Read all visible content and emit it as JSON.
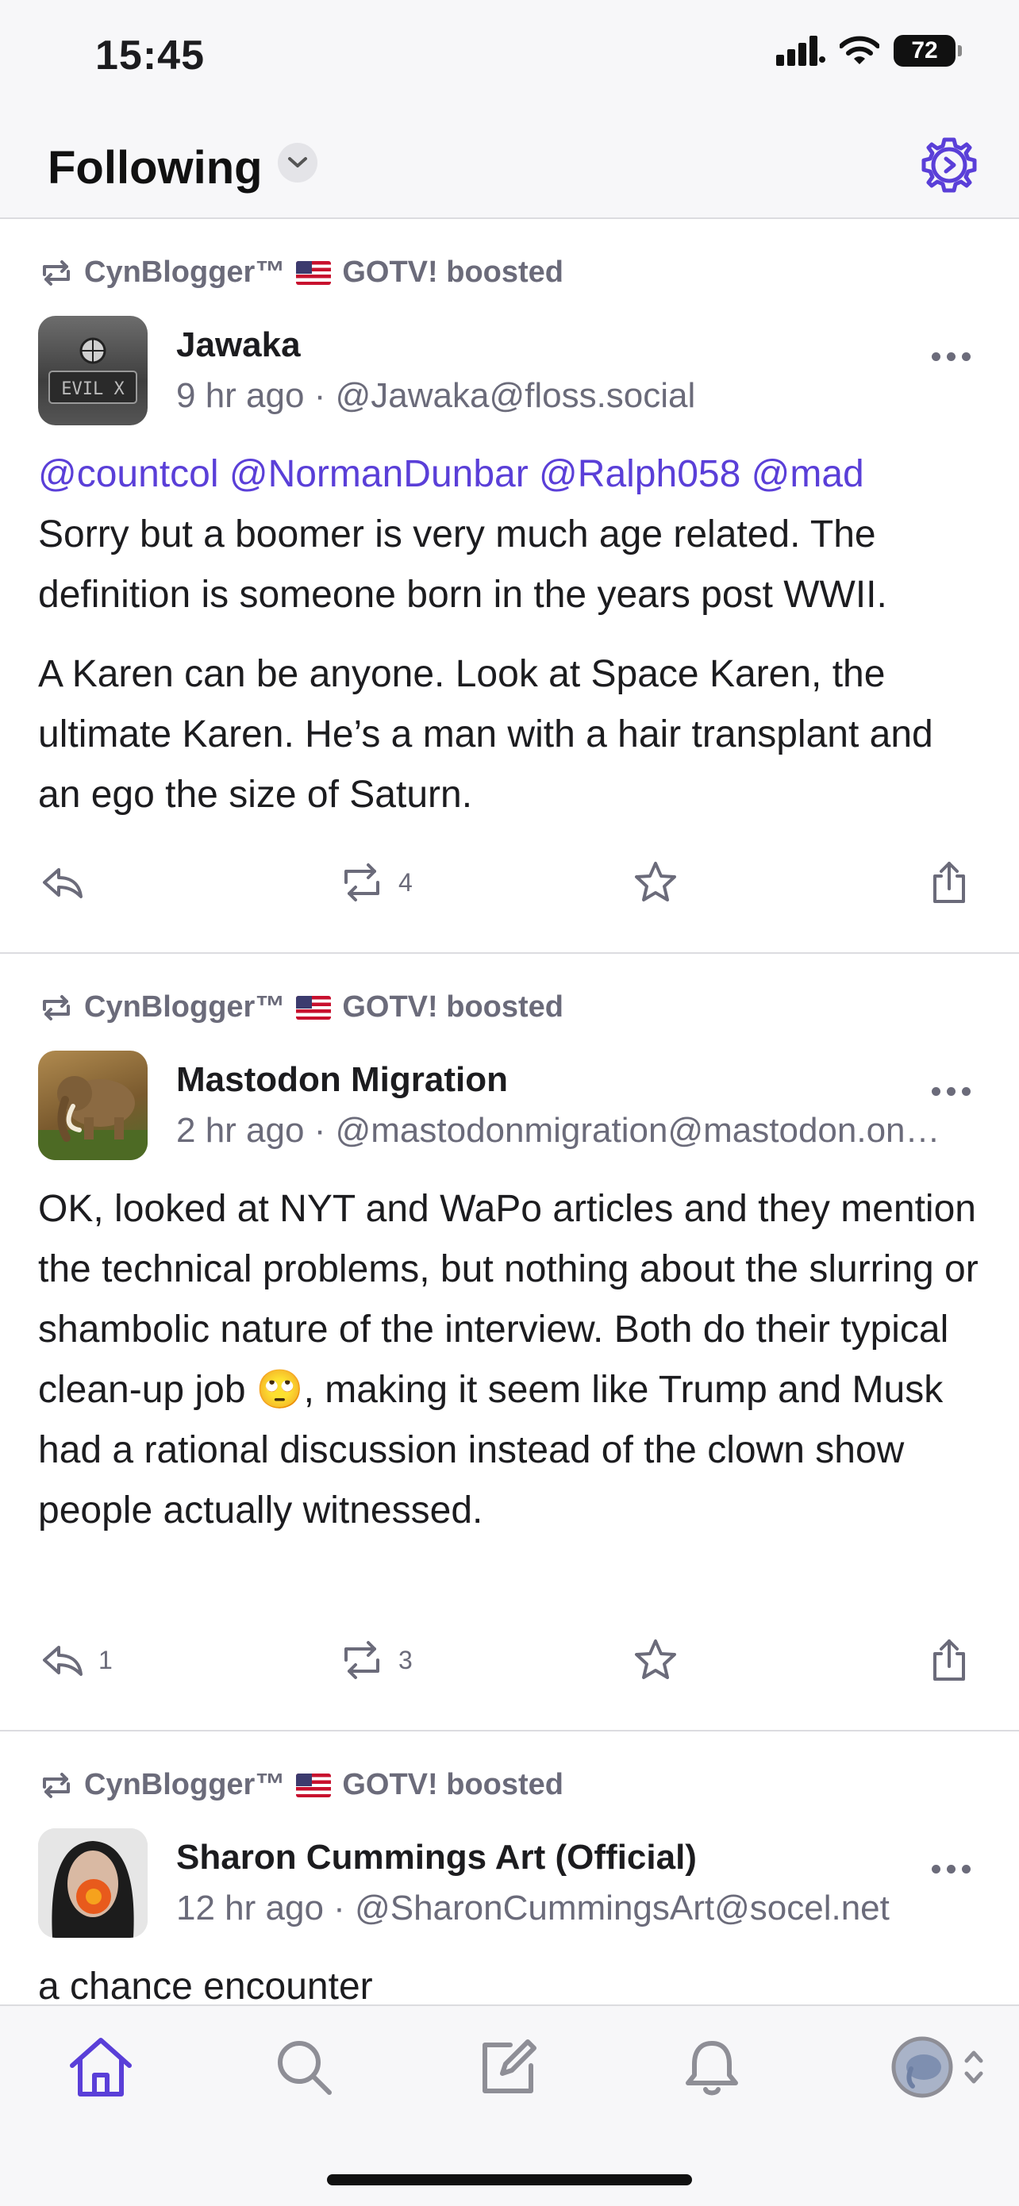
{
  "status_bar": {
    "time": "15:45",
    "battery": "72"
  },
  "header": {
    "title": "Following"
  },
  "posts": [
    {
      "boost": {
        "booster": "CynBlogger™",
        "booster_suffix": "GOTV! boosted"
      },
      "author_name": "Jawaka",
      "time_ago": "9 hr ago",
      "handle": "@Jawaka@floss.social",
      "avatar_text": "EVIL X",
      "mentions": "@countcol @NormanDunbar @Ralph058 @mad",
      "paragraph1": "Sorry but a boomer is very much age related. The definition is someone born  in the years post WWII.",
      "paragraph2": "A Karen can be anyone. Look at Space Karen, the ultimate Karen. He’s a man with a hair transplant and an ego the size of Saturn.",
      "reply_count": "",
      "boost_count": "4"
    },
    {
      "boost": {
        "booster": "CynBlogger™",
        "booster_suffix": "GOTV! boosted"
      },
      "author_name": "Mastodon Migration",
      "time_ago": "2 hr ago",
      "handle": "@mastodonmigration@mastodon.on…",
      "paragraph1": "OK, looked at NYT and WaPo articles and they mention the technical problems, but nothing about the slurring or shambolic nature of the interview. Both do their typical clean-up job 🙄, making it seem like Trump and Musk had a rational discussion instead of the clown show people actually witnessed.",
      "reply_count": "1",
      "boost_count": "3"
    },
    {
      "boost": {
        "booster": "CynBlogger™",
        "booster_suffix": "GOTV! boosted"
      },
      "author_name": "Sharon Cummings Art (Official)",
      "time_ago": "12 hr ago",
      "handle": "@SharonCummingsArt@socel.net",
      "paragraph1": "a chance encounter"
    }
  ],
  "separator": "·",
  "colors": {
    "accent": "#5a3fd8",
    "muted": "#6b6b7a"
  },
  "tabs": [
    "home-icon",
    "search-icon",
    "compose-icon",
    "bell-icon",
    "account-avatar"
  ]
}
